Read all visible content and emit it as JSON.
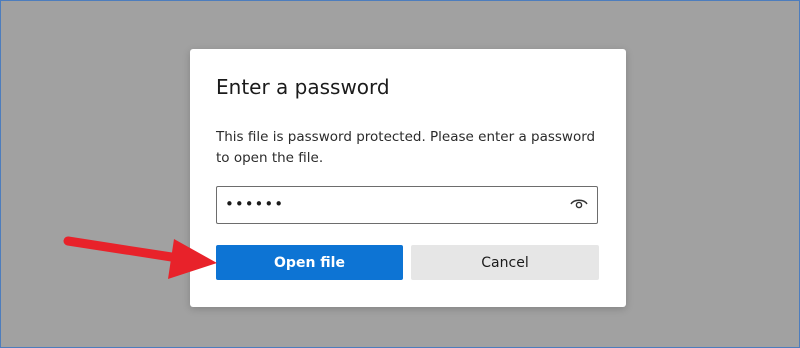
{
  "dialog": {
    "title": "Enter a password",
    "message": "This file is password protected. Please enter a password to open the file.",
    "password_value": "••••••",
    "reveal_icon": "eye-icon",
    "open_label": "Open file",
    "cancel_label": "Cancel"
  },
  "colors": {
    "backdrop": "#a1a1a1",
    "primary_button": "#0d74d4",
    "secondary_button": "#e6e6e6",
    "annotation_arrow": "#e8222a"
  }
}
